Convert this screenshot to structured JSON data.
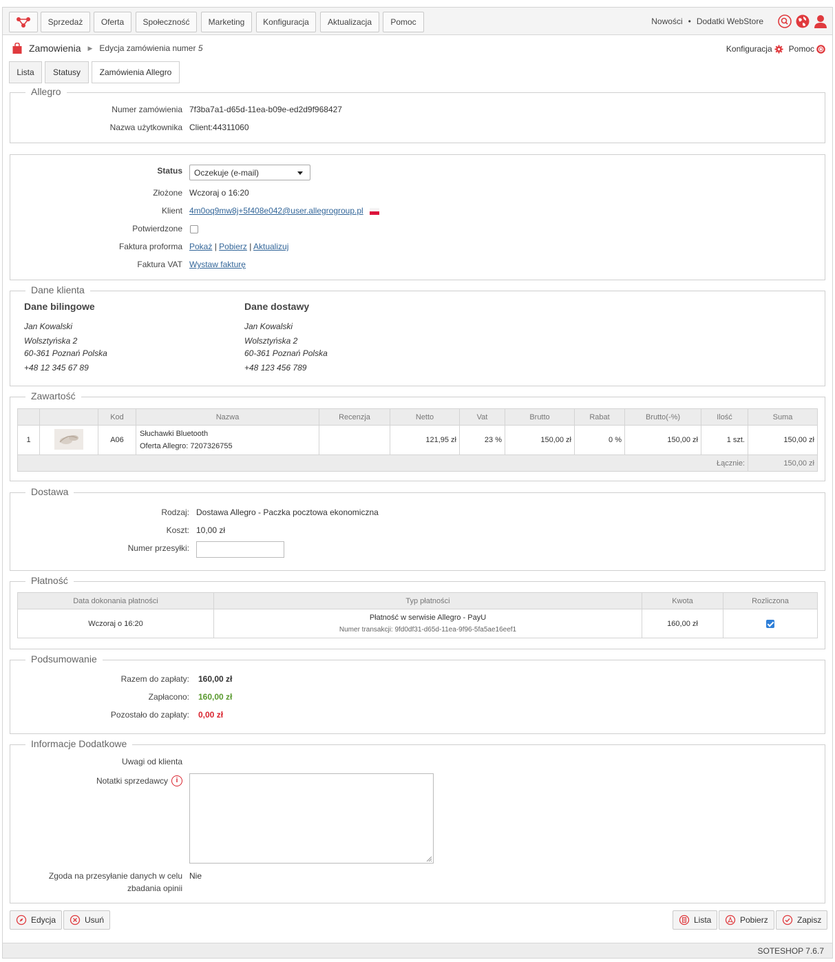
{
  "nav": {
    "items": [
      "Sprzedaż",
      "Oferta",
      "Społeczność",
      "Marketing",
      "Konfiguracja",
      "Aktualizacja",
      "Pomoc"
    ],
    "news": "Nowości",
    "separator": "•",
    "addons": "Dodatki WebStore",
    "icons": [
      "search-icon",
      "globe-icon",
      "user-icon"
    ],
    "accent": "#e03a3e"
  },
  "breadcrumb": {
    "section": "Zamowienia",
    "current_prefix": "Edycja zamówienia numer",
    "current_number": "5"
  },
  "header_links": {
    "config": "Konfiguracja",
    "help": "Pomoc"
  },
  "tabs": [
    "Lista",
    "Statusy",
    "Zamówienia Allegro"
  ],
  "allegro": {
    "legend": "Allegro",
    "order_number_label": "Numer zamówienia",
    "order_number": "7f3ba7a1-d65d-11ea-b09e-ed2d9f968427",
    "username_label": "Nazwa użytkownika",
    "username": "Client:44311060"
  },
  "order": {
    "status_label": "Status",
    "status_value": "Oczekuje (e-mail)",
    "placed_label": "Złożone",
    "placed_value": "Wczoraj o 16:20",
    "client_label": "Klient",
    "client_email": "4m0oq9mw8j+5f408e042@user.allegrogroup.pl",
    "confirmed_label": "Potwierdzone",
    "confirmed": false,
    "proforma_label": "Faktura proforma",
    "proforma_links": [
      "Pokaż",
      "Pobierz",
      "Aktualizuj"
    ],
    "link_sep": "|",
    "vat_label": "Faktura VAT",
    "vat_link": "Wystaw fakturę"
  },
  "client": {
    "legend": "Dane klienta",
    "billing_title": "Dane bilingowe",
    "billing": [
      "Jan Kowalski",
      "Wolsztyńska 2",
      "60-361 Poznań Polska",
      "+48 12 345 67 89"
    ],
    "delivery_title": "Dane dostawy",
    "delivery": [
      "Jan Kowalski",
      "Wolsztyńska 2",
      "60-361 Poznań Polska",
      "+48 123 456 789"
    ]
  },
  "contents": {
    "legend": "Zawartość",
    "headers": [
      "",
      "",
      "Kod",
      "Nazwa",
      "Recenzja",
      "Netto",
      "Vat",
      "Brutto",
      "Rabat",
      "Brutto(-%)",
      "Ilość",
      "Suma"
    ],
    "row": {
      "index": "1",
      "code": "A06",
      "name": "Słuchawki Bluetooth",
      "offer_label": "Oferta Allegro:",
      "offer_id": "7207326755",
      "review": "",
      "net": "121,95 zł",
      "vat": "23 %",
      "gross": "150,00 zł",
      "discount": "0 %",
      "gross_disc": "150,00 zł",
      "qty": "1 szt.",
      "sum": "150,00 zł"
    },
    "total_label": "Łącznie:",
    "total_value": "150,00 zł"
  },
  "delivery": {
    "legend": "Dostawa",
    "type_label": "Rodzaj:",
    "type_value": "Dostawa Allegro - Paczka pocztowa ekonomiczna",
    "cost_label": "Koszt:",
    "cost_value": "10,00 zł",
    "tracking_label": "Numer przesyłki:",
    "tracking_value": ""
  },
  "payment": {
    "legend": "Płatność",
    "headers": [
      "Data dokonania płatności",
      "Typ płatności",
      "Kwota",
      "Rozliczona"
    ],
    "date": "Wczoraj o 16:20",
    "type": "Płatność w serwisie Allegro - PayU",
    "transaction": "Numer transakcji: 9fd0df31-d65d-11ea-9f96-5fa5ae16eef1",
    "amount": "160,00 zł",
    "settled": true
  },
  "summary": {
    "legend": "Podsumowanie",
    "total_label": "Razem do zapłaty:",
    "total_value": "160,00 zł",
    "paid_label": "Zapłacono:",
    "paid_value": "160,00 zł",
    "left_label": "Pozostało do zapłaty:",
    "left_value": "0,00 zł"
  },
  "extra": {
    "legend": "Informacje Dodatkowe",
    "client_notes_label": "Uwagi od klienta",
    "seller_notes_label": "Notatki sprzedawcy",
    "seller_notes_value": "",
    "consent_label_1": "Zgoda na przesyłanie danych w celu",
    "consent_label_2": "zbadania opinii",
    "consent_value": "Nie"
  },
  "actions": {
    "edit": "Edycja",
    "delete": "Usuń",
    "list": "Lista",
    "download": "Pobierz",
    "save": "Zapisz"
  },
  "footer": {
    "version": "SOTESHOP 7.6.7"
  }
}
